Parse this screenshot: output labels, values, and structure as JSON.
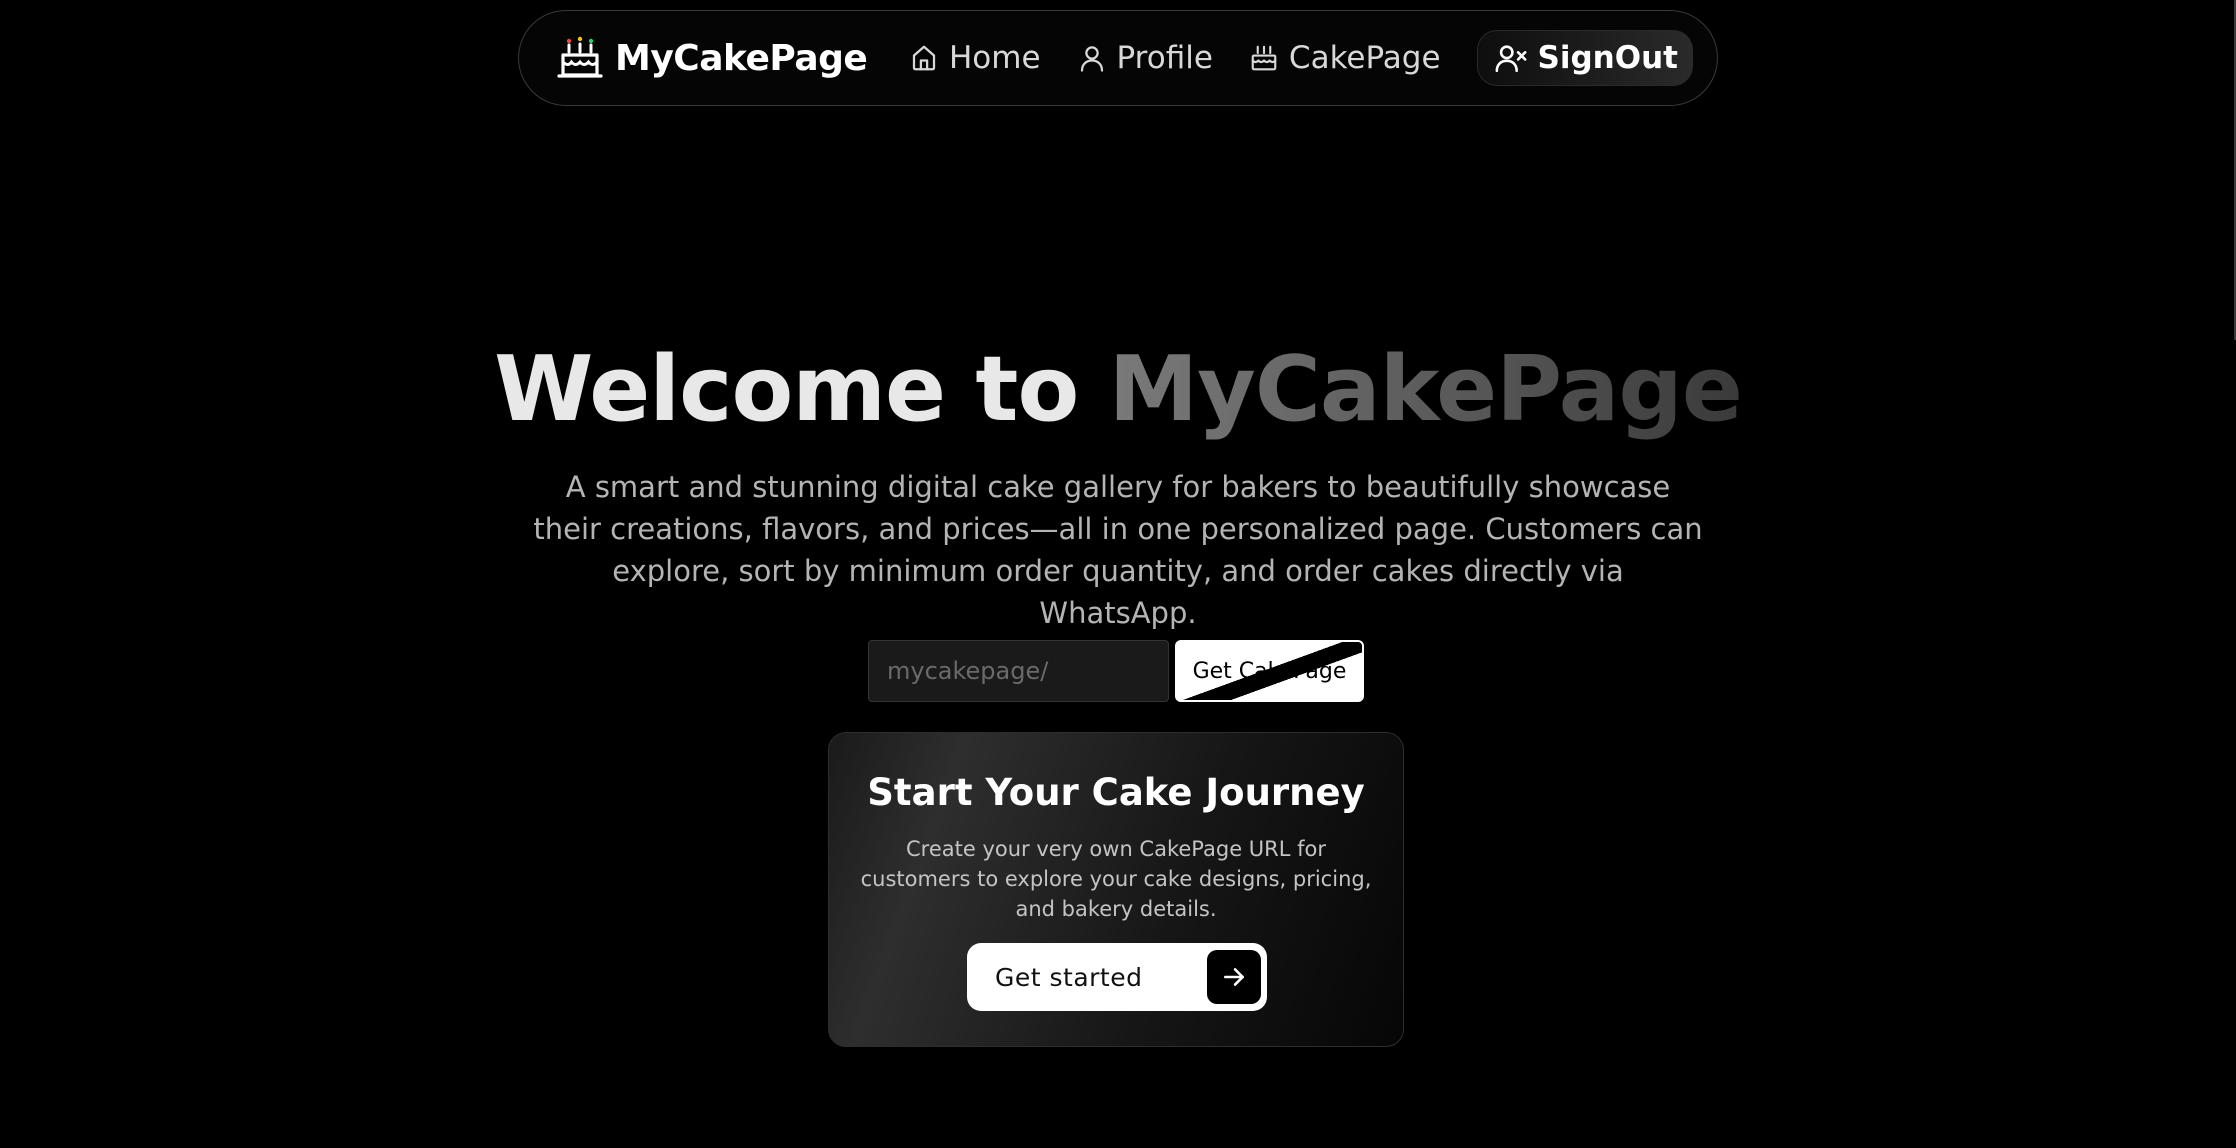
{
  "nav": {
    "brand": "MyCakePage",
    "brand_icon": "cake-logo-icon",
    "links": [
      {
        "label": "Home",
        "icon": "home-icon"
      },
      {
        "label": "Profile",
        "icon": "user-icon"
      },
      {
        "label": "CakePage",
        "icon": "cake-icon"
      }
    ],
    "signout_label": "SignOut",
    "signout_icon": "user-x-icon"
  },
  "hero": {
    "title_prefix": "Welcome to",
    "title_brand": "MyCakePage",
    "description": "A smart and stunning digital cake gallery for bakers to beautifully showcase their creations, flavors, and prices—all in one personalized page. Customers can explore, sort by minimum order quantity, and order cakes directly via WhatsApp."
  },
  "url_form": {
    "placeholder": "mycakepage/",
    "value": "",
    "button_label": "Get CakePage"
  },
  "card": {
    "title": "Start Your Cake Journey",
    "text": "Create your very own CakePage URL for customers to explore your cake designs, pricing, and bakery details.",
    "button_label": "Get started",
    "button_icon": "arrow-right-icon"
  },
  "colors": {
    "background": "#000000",
    "accent_white": "#ffffff",
    "muted_text": "#b4b4b4"
  }
}
